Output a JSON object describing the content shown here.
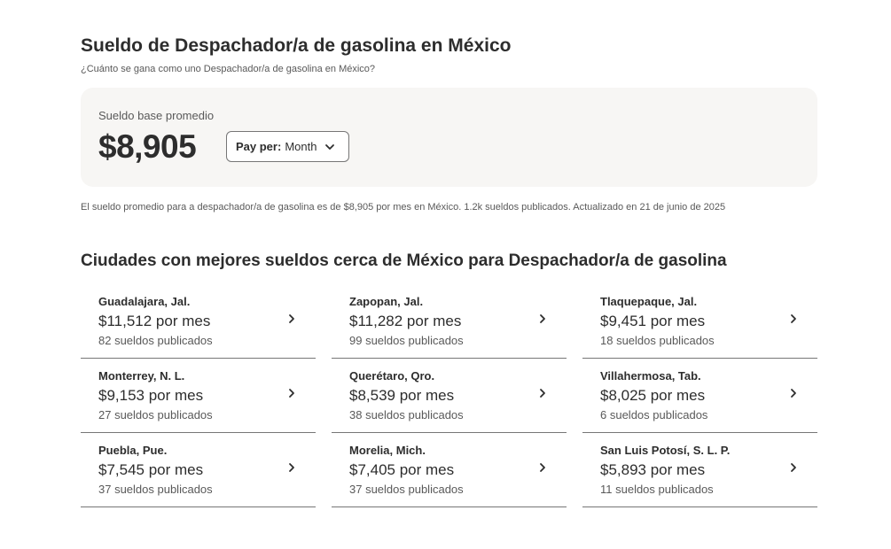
{
  "header": {
    "title": "Sueldo de Despachador/a de gasolina en México",
    "subtitle": "¿Cuánto se gana como uno Despachador/a de gasolina en México?"
  },
  "summary": {
    "label": "Sueldo base promedio",
    "value": "$8,905",
    "pay_per_label": "Pay per:",
    "pay_per_value": "Month"
  },
  "footnote": "El sueldo promedio para a despachador/a de gasolina es de $8,905 por mes en México.  1.2k sueldos publicados. Actualizado en 21 de junio de 2025",
  "cities_section": {
    "title": "Ciudades con mejores sueldos cerca de México para Despachador/a de gasolina",
    "cities": [
      {
        "name": "Guadalajara, Jal.",
        "salary": "$11,512 por mes",
        "count": "82 sueldos publicados"
      },
      {
        "name": "Zapopan, Jal.",
        "salary": "$11,282 por mes",
        "count": "99 sueldos publicados"
      },
      {
        "name": "Tlaquepaque, Jal.",
        "salary": "$9,451 por mes",
        "count": "18 sueldos publicados"
      },
      {
        "name": "Monterrey, N. L.",
        "salary": "$9,153 por mes",
        "count": "27 sueldos publicados"
      },
      {
        "name": "Querétaro, Qro.",
        "salary": "$8,539 por mes",
        "count": "38 sueldos publicados"
      },
      {
        "name": "Villahermosa, Tab.",
        "salary": "$8,025 por mes",
        "count": "6 sueldos publicados"
      },
      {
        "name": "Puebla, Pue.",
        "salary": "$7,545 por mes",
        "count": "37 sueldos publicados"
      },
      {
        "name": "Morelia, Mich.",
        "salary": "$7,405 por mes",
        "count": "37 sueldos publicados"
      },
      {
        "name": "San Luis Potosí, S. L. P.",
        "salary": "$5,893 por mes",
        "count": "11 sueldos publicados"
      }
    ]
  },
  "icons": {
    "dropdown": "chevron-down-icon",
    "city_link": "chevron-right-icon"
  },
  "colors": {
    "text": "#2d2d2d",
    "muted": "#595959",
    "card_bg": "#f7f6f4",
    "divider": "#767676"
  }
}
